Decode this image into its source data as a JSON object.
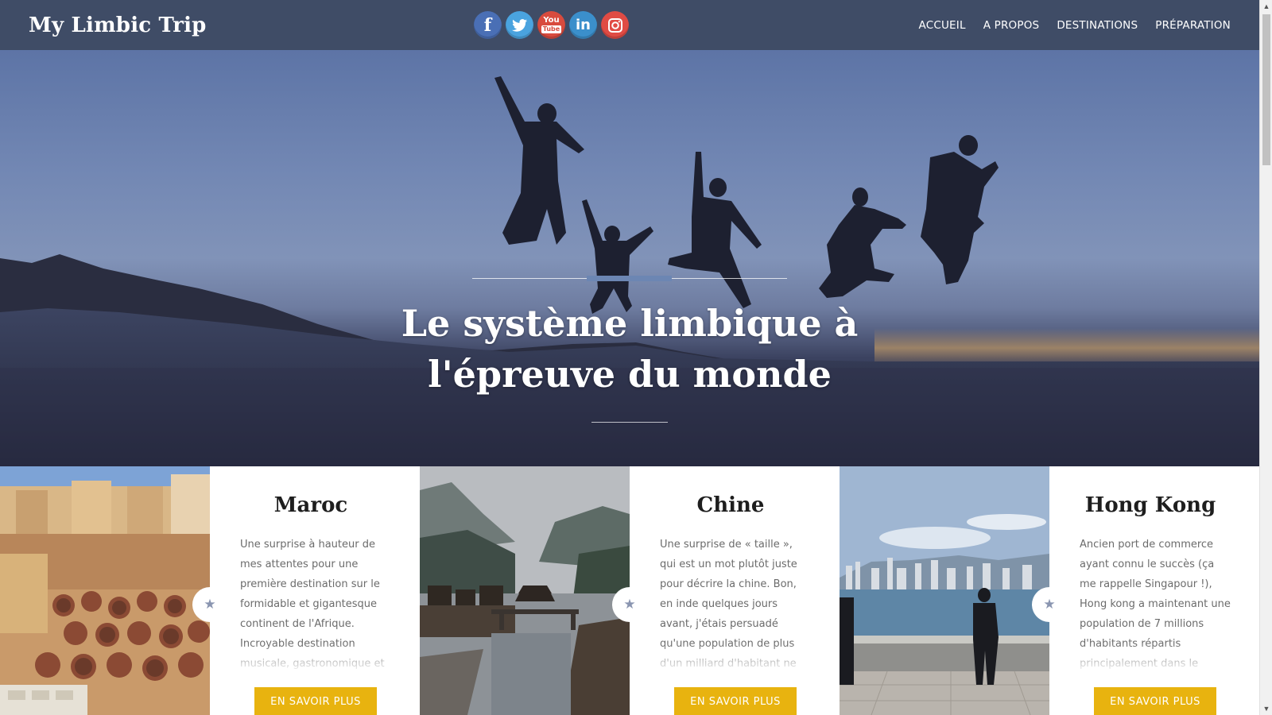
{
  "header": {
    "site_title": "My Limbic Trip",
    "social": [
      {
        "icon": "facebook-icon",
        "glyph": "f",
        "color": "#4a6fb5"
      },
      {
        "icon": "twitter-icon",
        "glyph": "t",
        "color": "#4aa3df"
      },
      {
        "icon": "youtube-icon",
        "glyph": "You",
        "color": "#d84b3e"
      },
      {
        "icon": "linkedin-icon",
        "glyph": "in",
        "color": "#3b8fcb"
      },
      {
        "icon": "instagram-icon",
        "glyph": "◎",
        "color": "#e04b44"
      }
    ],
    "nav": [
      "ACCUEIL",
      "A PROPOS",
      "DESTINATIONS",
      "PRÉPARATION"
    ]
  },
  "hero": {
    "title_line1": "Le système limbique à",
    "title_line2": "l'épreuve du monde"
  },
  "destinations": [
    {
      "name": "Maroc",
      "excerpt": "Une surprise à hauteur de mes attentes pour une première destination sur le formidable et gigantesque continent de l'Afrique. Incroyable destination musicale, gastronomique et sociale, le",
      "button": "EN SAVOIR PLUS"
    },
    {
      "name": "Chine",
      "excerpt": "Une surprise de « taille », qui est un mot plutôt juste pour décrire la chine. Bon, en inde quelques jours avant, j'étais persuadé qu'une population de plus d'un milliard d'habitant ne pouvait pas être",
      "button": "EN SAVOIR PLUS"
    },
    {
      "name": "Hong Kong",
      "excerpt": "Ancien port de commerce ayant connu le succès (ça me rappelle Singapour !), Hong kong a maintenant une population de 7 millions d'habitants répartis principalement dans le centre",
      "button": "EN SAVOIR PLUS"
    }
  ],
  "colors": {
    "header_bg": "#3f4c66",
    "accent_button": "#e8b30f",
    "hero_accent": "#6c86b3"
  }
}
